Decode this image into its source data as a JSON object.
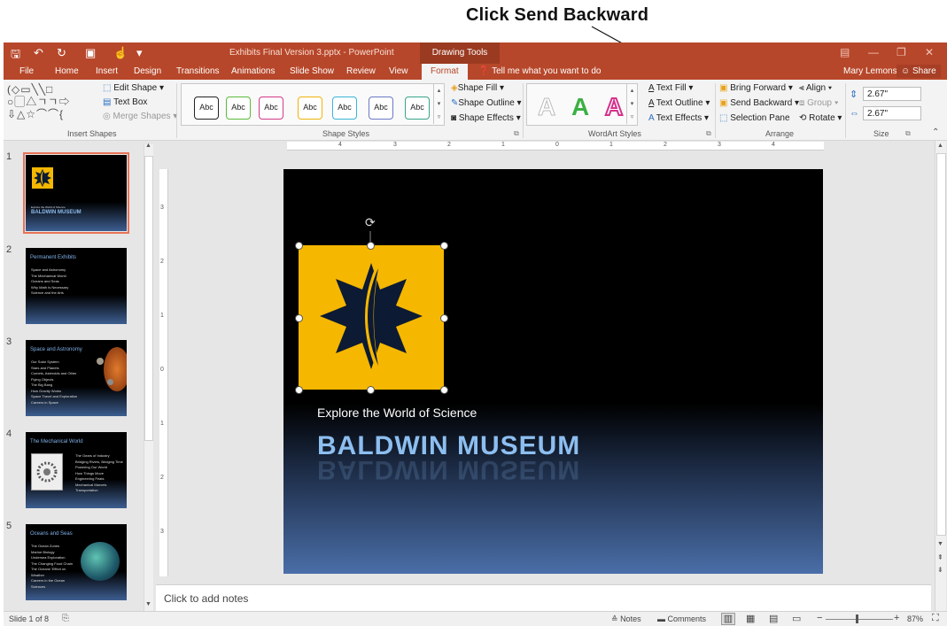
{
  "callout": "Click Send Backward",
  "window": {
    "title": "Exhibits Final Version 3.pptx - PowerPoint",
    "context_tab": "Drawing Tools",
    "user": "Mary Lemons",
    "share": "Share"
  },
  "tabs": [
    "File",
    "Home",
    "Insert",
    "Design",
    "Transitions",
    "Animations",
    "Slide Show",
    "Review",
    "View",
    "Format"
  ],
  "tell_me": "Tell me what you want to do",
  "ribbon": {
    "insert_shapes": {
      "label": "Insert Shapes",
      "edit_shape": "Edit Shape",
      "text_box": "Text Box",
      "merge_shapes": "Merge Shapes"
    },
    "shape_styles": {
      "label": "Shape Styles",
      "swatch": "Abc",
      "fill": "Shape Fill",
      "outline": "Shape Outline",
      "effects": "Shape Effects"
    },
    "wordart": {
      "label": "WordArt Styles",
      "letter": "A",
      "text_fill": "Text Fill",
      "text_outline": "Text Outline",
      "text_effects": "Text Effects"
    },
    "arrange": {
      "label": "Arrange",
      "bring_forward": "Bring Forward",
      "send_backward": "Send Backward",
      "selection_pane": "Selection Pane",
      "align": "Align",
      "group": "Group",
      "rotate": "Rotate"
    },
    "size": {
      "label": "Size",
      "height": "2.67\"",
      "width": "2.67\""
    }
  },
  "thumbnails": [
    {
      "num": "1",
      "title": "BALDWIN MUSEUM",
      "sub": "Explore the World of Science"
    },
    {
      "num": "2",
      "title": "Permanent Exhibits",
      "items": [
        "Space and Astronomy",
        "The Mechanical World",
        "Oceans and Seas",
        "Why Math Is Necessary",
        "Science and the Arts"
      ]
    },
    {
      "num": "3",
      "title": "Space and Astronomy",
      "items": [
        "Our Solar System",
        "Stars and Planets",
        "Comets, Asteroids and Other Flying Objects",
        "The Big Bang",
        "How Gravity Works",
        "Space Travel and Exploration",
        "Careers in Space"
      ]
    },
    {
      "num": "4",
      "title": "The Mechanical World",
      "items": [
        "The Gears of Industry",
        "Bridging Rivers, Bridging Time",
        "Powering Our World",
        "How Things Move",
        "Engineering Feats",
        "Mechanical Marvels",
        "Transportation"
      ]
    },
    {
      "num": "5",
      "title": "Oceans and Seas",
      "items": [
        "The Ocean Zones",
        "Marine Biology",
        "Undersea Exploration",
        "The Changing Food Chain",
        "The Oceans' Effect on Weather",
        "Careers in the Ocean Sciences"
      ]
    }
  ],
  "slide": {
    "subtitle": "Explore the World of Science",
    "title": "BALDWIN MUSEUM"
  },
  "notes_placeholder": "Click to add notes",
  "status": {
    "slide_of": "Slide 1 of 8",
    "notes": "Notes",
    "comments": "Comments",
    "zoom": "87%"
  },
  "ruler_labels": [
    "4",
    "3",
    "2",
    "1",
    "0",
    "1",
    "2",
    "3",
    "4"
  ],
  "vruler_labels": [
    "3",
    "2",
    "1",
    "0",
    "1",
    "2",
    "3"
  ]
}
